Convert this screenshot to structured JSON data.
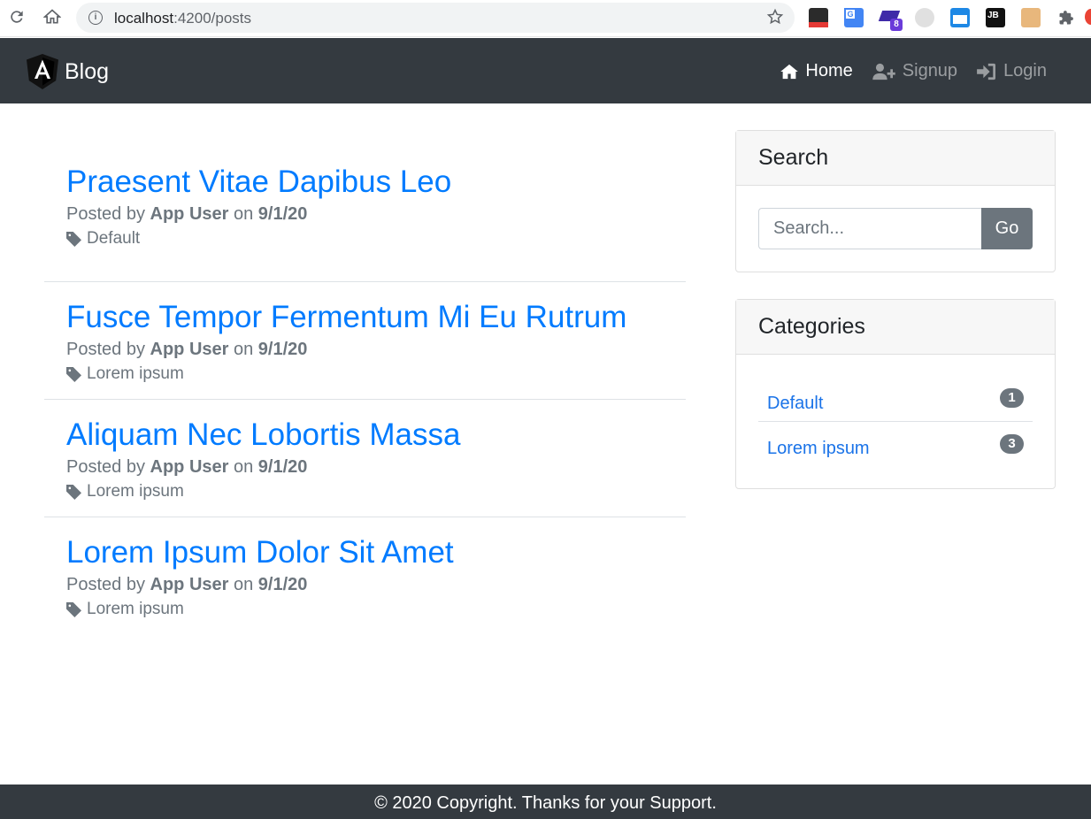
{
  "browser": {
    "url_host": "localhost",
    "url_path": ":4200/posts",
    "extension_badge": "8",
    "extension_jb": "JB"
  },
  "navbar": {
    "brand": "Blog",
    "links": [
      {
        "label": "Home",
        "icon": "home-icon",
        "active": true
      },
      {
        "label": "Signup",
        "icon": "user-plus-icon",
        "active": false
      },
      {
        "label": "Login",
        "icon": "sign-in-icon",
        "active": false
      }
    ]
  },
  "posts": [
    {
      "title": "Praesent Vitae Dapibus Leo",
      "prefix": "Posted by",
      "author": "App User",
      "on": "on",
      "date": "9/1/20",
      "category": "Default"
    },
    {
      "title": "Fusce Tempor Fermentum Mi Eu Rutrum",
      "prefix": "Posted by",
      "author": "App User",
      "on": "on",
      "date": "9/1/20",
      "category": "Lorem ipsum"
    },
    {
      "title": "Aliquam Nec Lobortis Massa",
      "prefix": "Posted by",
      "author": "App User",
      "on": "on",
      "date": "9/1/20",
      "category": "Lorem ipsum"
    },
    {
      "title": "Lorem Ipsum Dolor Sit Amet",
      "prefix": "Posted by",
      "author": "App User",
      "on": "on",
      "date": "9/1/20",
      "category": "Lorem ipsum"
    }
  ],
  "search": {
    "title": "Search",
    "placeholder": "Search...",
    "button": "Go"
  },
  "categories": {
    "title": "Categories",
    "items": [
      {
        "name": "Default",
        "count": "1"
      },
      {
        "name": "Lorem ipsum",
        "count": "3"
      }
    ]
  },
  "footer": {
    "text": "© 2020 Copyright. Thanks for your Support."
  },
  "colors": {
    "navbar": "#343a40",
    "link": "#007bff",
    "muted": "#6c757d"
  }
}
